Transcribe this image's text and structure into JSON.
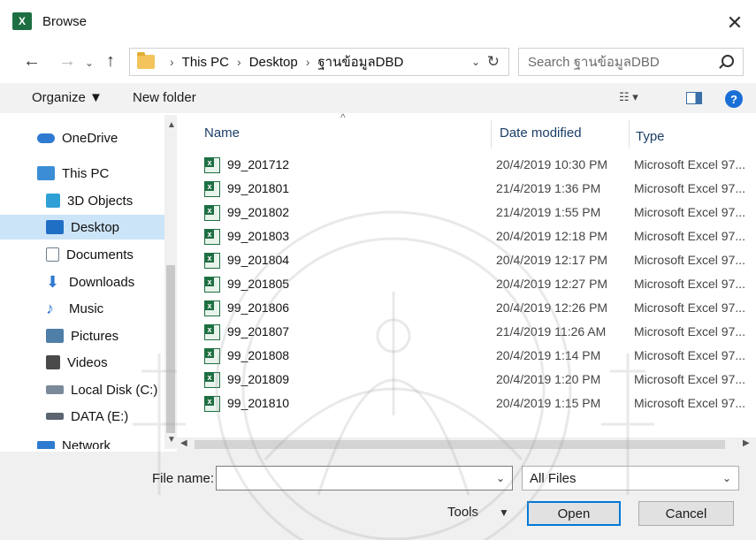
{
  "window": {
    "title": "Browse",
    "app_icon": "X"
  },
  "nav": {
    "path": [
      "This PC",
      "Desktop",
      "ฐานข้อมูลDBD"
    ]
  },
  "search": {
    "placeholder": "Search ฐานข้อมูลDBD"
  },
  "toolbar": {
    "organize": "Organize ▼",
    "new_folder": "New folder"
  },
  "sidebar": {
    "items": [
      {
        "label": "OneDrive",
        "icon": "cloud-icon",
        "color": "#2f7ad1"
      },
      {
        "label": "This PC",
        "icon": "computer-icon",
        "color": "#3b8ed6"
      },
      {
        "label": "3D Objects",
        "icon": "cube-icon",
        "color": "#2fa0d6"
      },
      {
        "label": "Desktop",
        "icon": "desktop-icon",
        "color": "#1f6fc5",
        "selected": true
      },
      {
        "label": "Documents",
        "icon": "document-icon",
        "color": "#6d7d8c"
      },
      {
        "label": "Downloads",
        "icon": "download-icon",
        "color": "#2f7ad1"
      },
      {
        "label": "Music",
        "icon": "music-icon",
        "color": "#2f7ad1"
      },
      {
        "label": "Pictures",
        "icon": "pictures-icon",
        "color": "#4f7ea8"
      },
      {
        "label": "Videos",
        "icon": "video-icon",
        "color": "#4a4a4a"
      },
      {
        "label": "Local Disk (C:)",
        "icon": "disk-icon",
        "color": "#7a8a99"
      },
      {
        "label": "DATA (E:)",
        "icon": "drive-icon",
        "color": "#5a6570"
      },
      {
        "label": "Network",
        "icon": "network-icon",
        "color": "#2f7ad1"
      }
    ]
  },
  "columns": {
    "name": "Name",
    "date": "Date modified",
    "type": "Type"
  },
  "files": [
    {
      "name": "99_201712",
      "date": "20/4/2019 10:30 PM",
      "type": "Microsoft Excel 97..."
    },
    {
      "name": "99_201801",
      "date": "21/4/2019 1:36 PM",
      "type": "Microsoft Excel 97..."
    },
    {
      "name": "99_201802",
      "date": "21/4/2019 1:55 PM",
      "type": "Microsoft Excel 97..."
    },
    {
      "name": "99_201803",
      "date": "20/4/2019 12:18 PM",
      "type": "Microsoft Excel 97..."
    },
    {
      "name": "99_201804",
      "date": "20/4/2019 12:17 PM",
      "type": "Microsoft Excel 97..."
    },
    {
      "name": "99_201805",
      "date": "20/4/2019 12:27 PM",
      "type": "Microsoft Excel 97..."
    },
    {
      "name": "99_201806",
      "date": "20/4/2019 12:26 PM",
      "type": "Microsoft Excel 97..."
    },
    {
      "name": "99_201807",
      "date": "21/4/2019 11:26 AM",
      "type": "Microsoft Excel 97..."
    },
    {
      "name": "99_201808",
      "date": "20/4/2019 1:14 PM",
      "type": "Microsoft Excel 97..."
    },
    {
      "name": "99_201809",
      "date": "20/4/2019 1:20 PM",
      "type": "Microsoft Excel 97..."
    },
    {
      "name": "99_201810",
      "date": "20/4/2019 1:15 PM",
      "type": "Microsoft Excel 97..."
    }
  ],
  "bottom": {
    "file_name_label": "File name:",
    "file_name_value": "",
    "file_type": "All Files",
    "tools": "Tools",
    "open": "Open",
    "cancel": "Cancel"
  }
}
